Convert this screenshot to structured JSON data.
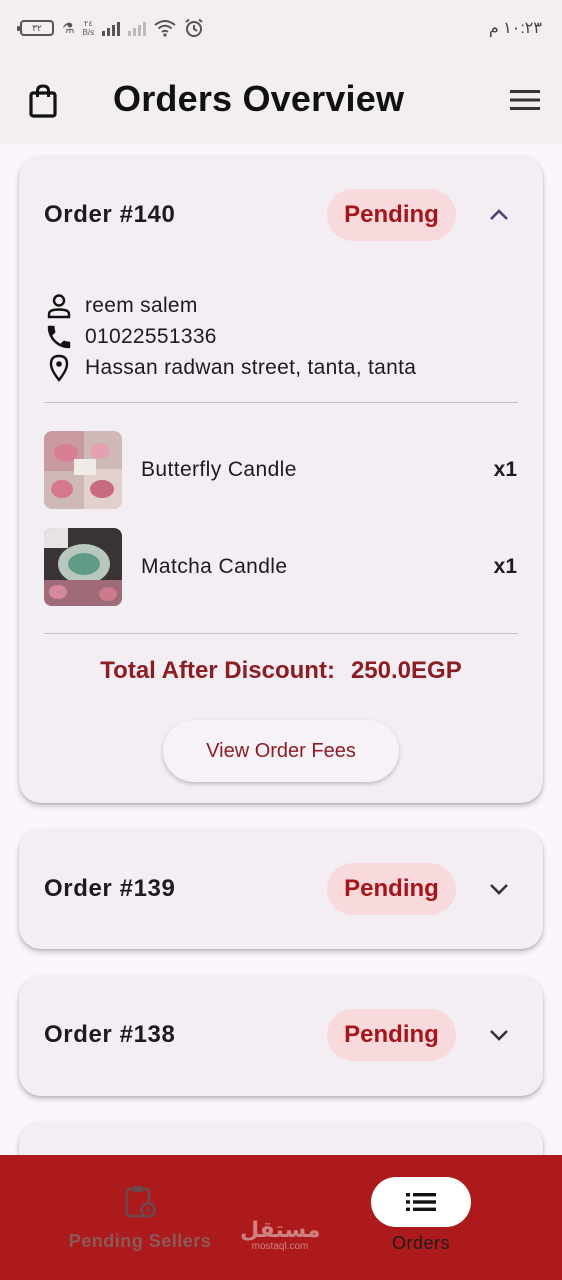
{
  "status_bar": {
    "time": "١٠:٢٣ م",
    "battery": "٣٢",
    "net_speed_value": "٢٤",
    "net_speed_unit": "B/s"
  },
  "header": {
    "title": "Orders Overview"
  },
  "orders": [
    {
      "title": "Order #140",
      "status": "Pending",
      "expanded": true,
      "customer_name": "reem salem",
      "phone": "01022551336",
      "address": "Hassan radwan street, tanta, tanta",
      "items": [
        {
          "name": "Butterfly Candle",
          "qty": "x1"
        },
        {
          "name": "Matcha Candle",
          "qty": "x1"
        }
      ],
      "total_label": "Total After Discount:",
      "total_value": "250.0EGP",
      "fees_button": "View Order Fees"
    },
    {
      "title": "Order #139",
      "status": "Pending",
      "expanded": false
    },
    {
      "title": "Order #138",
      "status": "Pending",
      "expanded": false
    }
  ],
  "bottom_nav": {
    "items": [
      {
        "label": "Pending Sellers",
        "active": false
      },
      {
        "label": "Orders",
        "active": true
      }
    ]
  },
  "watermark": {
    "main": "مستقل",
    "sub": "mostaql.com"
  },
  "colors": {
    "accent": "#ad1a1b",
    "status_badge_bg": "#f8dadd",
    "status_badge_text": "#a4161a",
    "total_text": "#8c1d22",
    "card_bg": "#f3eef4"
  }
}
